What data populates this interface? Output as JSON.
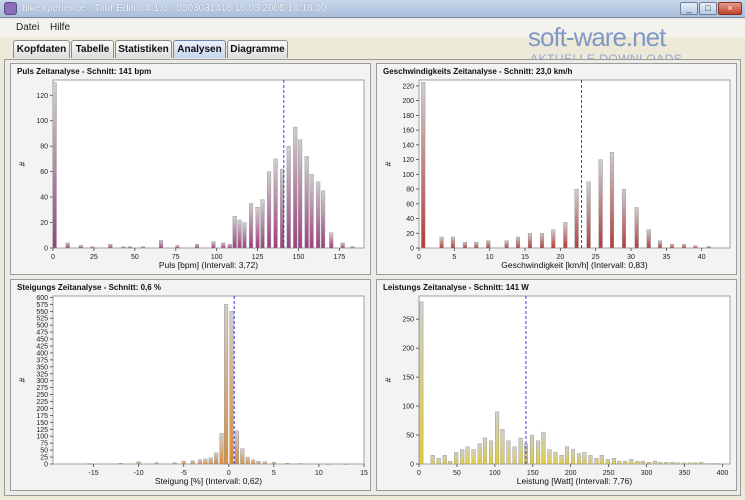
{
  "window": {
    "title": "bikeXperience - Tour Editor 4.1.0 - 0503031418 16.03.2005 14:18:00",
    "buttons": [
      "_",
      "□",
      "×"
    ]
  },
  "menu": {
    "items": [
      "Datei",
      "Hilfe"
    ]
  },
  "tabs": [
    {
      "label": "Kopfdaten",
      "active": false
    },
    {
      "label": "Tabelle",
      "active": false
    },
    {
      "label": "Statistiken",
      "active": false
    },
    {
      "label": "Analysen",
      "active": true
    },
    {
      "label": "Diagramme",
      "active": false
    }
  ],
  "watermark": {
    "logo": "soft-ware.net",
    "sub": "AKTUELLE DOWNLOADS"
  },
  "panels": [
    {
      "title": "Puls Zeitanalyse - Schnitt: 141 bpm",
      "xlabel": "Puls [bpm]   (Intervall: 3,72)",
      "ylabel": "#",
      "xlim": [
        0,
        190
      ],
      "ylim": [
        0,
        132
      ],
      "xticks": [
        0,
        25,
        50,
        75,
        100,
        125,
        150,
        175
      ],
      "yticks": [
        0,
        20,
        40,
        60,
        80,
        100,
        120
      ],
      "mean": 141,
      "color": "#9e3f7f",
      "bins": [
        [
          1,
          130
        ],
        [
          9,
          4
        ],
        [
          17,
          2
        ],
        [
          24,
          1
        ],
        [
          35,
          3
        ],
        [
          43,
          1
        ],
        [
          47,
          1
        ],
        [
          55,
          1
        ],
        [
          66,
          6
        ],
        [
          76,
          2
        ],
        [
          88,
          3
        ],
        [
          98,
          5
        ],
        [
          104,
          4
        ],
        [
          108,
          3
        ],
        [
          111,
          25
        ],
        [
          114,
          22
        ],
        [
          117,
          20
        ],
        [
          121,
          35
        ],
        [
          125,
          32
        ],
        [
          128,
          38
        ],
        [
          132,
          60
        ],
        [
          136,
          70
        ],
        [
          140,
          62
        ],
        [
          144,
          80
        ],
        [
          148,
          95
        ],
        [
          151,
          85
        ],
        [
          155,
          72
        ],
        [
          158,
          58
        ],
        [
          162,
          52
        ],
        [
          165,
          45
        ],
        [
          170,
          12
        ],
        [
          177,
          4
        ],
        [
          183,
          1
        ]
      ]
    },
    {
      "title": "Geschwindigkeits Zeitanalyse - Schnitt: 23,0 km/h",
      "xlabel": "Geschwindigkeit [km/h]   (Intervall: 0,83)",
      "ylabel": "#",
      "xlim": [
        0,
        44
      ],
      "ylim": [
        0,
        228
      ],
      "xticks": [
        0,
        5,
        10,
        15,
        20,
        25,
        30,
        35,
        40
      ],
      "yticks": [
        0,
        20,
        40,
        60,
        80,
        100,
        120,
        140,
        160,
        180,
        200,
        220
      ],
      "mean": 23,
      "color": "#b73a3a",
      "bins": [
        [
          0.6,
          225
        ],
        [
          3.2,
          15
        ],
        [
          4.8,
          15
        ],
        [
          6.5,
          8
        ],
        [
          8.1,
          8
        ],
        [
          9.8,
          10
        ],
        [
          12.4,
          10
        ],
        [
          14,
          15
        ],
        [
          15.7,
          20
        ],
        [
          17.4,
          20
        ],
        [
          19,
          25
        ],
        [
          20.7,
          35
        ],
        [
          22.3,
          80
        ],
        [
          24,
          90
        ],
        [
          25.7,
          120
        ],
        [
          27.3,
          130
        ],
        [
          29,
          80
        ],
        [
          30.8,
          55
        ],
        [
          32.5,
          25
        ],
        [
          34.1,
          10
        ],
        [
          35.8,
          5
        ],
        [
          37.5,
          5
        ],
        [
          39.1,
          3
        ],
        [
          41,
          2
        ]
      ]
    },
    {
      "title": "Steigungs Zeitanalyse - Schnitt: 0,6 %",
      "xlabel": "Steigung [%]   (Intervall: 0,62)",
      "ylabel": "#",
      "xlim": [
        -19.5,
        15
      ],
      "ylim": [
        0,
        605
      ],
      "xticks": [
        -15,
        -10,
        -5,
        0,
        5,
        10,
        15
      ],
      "yticks": [
        0,
        25,
        50,
        75,
        100,
        125,
        150,
        175,
        200,
        225,
        250,
        275,
        300,
        325,
        350,
        375,
        400,
        425,
        450,
        475,
        500,
        525,
        550,
        575,
        600
      ],
      "mean": 0.6,
      "color": "#d98c3a",
      "bins": [
        [
          -15.5,
          2
        ],
        [
          -12,
          3
        ],
        [
          -10,
          8
        ],
        [
          -8,
          5
        ],
        [
          -6,
          5
        ],
        [
          -5,
          10
        ],
        [
          -4,
          12
        ],
        [
          -3.2,
          15
        ],
        [
          -2.6,
          18
        ],
        [
          -2,
          22
        ],
        [
          -1.4,
          40
        ],
        [
          -0.8,
          110
        ],
        [
          -0.3,
          575
        ],
        [
          0.3,
          550
        ],
        [
          0.9,
          120
        ],
        [
          1.5,
          55
        ],
        [
          2.1,
          25
        ],
        [
          2.7,
          15
        ],
        [
          3.3,
          10
        ],
        [
          4,
          8
        ],
        [
          5,
          6
        ],
        [
          6.5,
          3
        ],
        [
          8,
          2
        ],
        [
          11,
          1
        ],
        [
          13,
          1
        ]
      ]
    },
    {
      "title": "Leistungs Zeitanalyse - Schnitt: 141 W",
      "xlabel": "Leistung [Watt]   (Intervall: 7,76)",
      "ylabel": "#",
      "xlim": [
        0,
        410
      ],
      "ylim": [
        0,
        290
      ],
      "xticks": [
        0,
        50,
        100,
        150,
        200,
        250,
        300,
        350,
        400
      ],
      "yticks": [
        0,
        50,
        100,
        150,
        200,
        250
      ],
      "mean": 141,
      "color": "#e0cc3a",
      "bins": [
        [
          3,
          280
        ],
        [
          18,
          15
        ],
        [
          26,
          10
        ],
        [
          34,
          15
        ],
        [
          41,
          5
        ],
        [
          49,
          20
        ],
        [
          57,
          25
        ],
        [
          64,
          30
        ],
        [
          72,
          25
        ],
        [
          80,
          35
        ],
        [
          87,
          45
        ],
        [
          95,
          40
        ],
        [
          103,
          90
        ],
        [
          110,
          60
        ],
        [
          118,
          40
        ],
        [
          126,
          30
        ],
        [
          134,
          45
        ],
        [
          141,
          35
        ],
        [
          149,
          50
        ],
        [
          157,
          40
        ],
        [
          164,
          55
        ],
        [
          172,
          25
        ],
        [
          180,
          20
        ],
        [
          188,
          15
        ],
        [
          195,
          30
        ],
        [
          203,
          25
        ],
        [
          211,
          18
        ],
        [
          218,
          20
        ],
        [
          226,
          15
        ],
        [
          234,
          10
        ],
        [
          241,
          15
        ],
        [
          249,
          8
        ],
        [
          257,
          10
        ],
        [
          264,
          5
        ],
        [
          272,
          5
        ],
        [
          280,
          8
        ],
        [
          288,
          5
        ],
        [
          295,
          5
        ],
        [
          303,
          3
        ],
        [
          311,
          5
        ],
        [
          318,
          3
        ],
        [
          326,
          3
        ],
        [
          334,
          3
        ],
        [
          341,
          2
        ],
        [
          349,
          2
        ],
        [
          357,
          2
        ],
        [
          364,
          2
        ],
        [
          372,
          3
        ],
        [
          380,
          1
        ],
        [
          388,
          1
        ],
        [
          395,
          1
        ]
      ]
    }
  ]
}
